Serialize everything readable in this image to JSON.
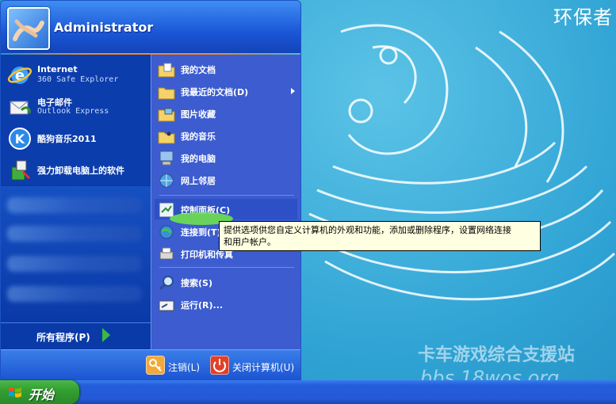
{
  "desktop": {
    "wallpaper_text": "环保者",
    "watermark_line1": "卡车游戏综合支援站",
    "watermark_line2": "bbs.18wos.org"
  },
  "start_menu": {
    "user_name": "Administrator",
    "pinned": [
      {
        "title": "Internet",
        "subtitle": "360 Safe Explorer",
        "icon": "internet-explorer-icon"
      },
      {
        "title": "电子邮件",
        "subtitle": "Outlook Express",
        "icon": "email-icon"
      }
    ],
    "recent": [
      {
        "title": "酷狗音乐2011",
        "icon": "kugou-music-icon"
      },
      {
        "title": "强力卸载电脑上的软件",
        "icon": "uninstall-software-icon"
      }
    ],
    "all_programs": "所有程序(P)",
    "right_items": [
      {
        "label": "我的文档",
        "icon": "my-documents-icon"
      },
      {
        "label": "我最近的文档(D)",
        "icon": "recent-documents-icon",
        "has_submenu": true
      },
      {
        "label": "图片收藏",
        "icon": "my-pictures-icon"
      },
      {
        "label": "我的音乐",
        "icon": "my-music-icon"
      },
      {
        "label": "我的电脑",
        "icon": "my-computer-icon"
      },
      {
        "label": "网上邻居",
        "icon": "network-places-icon"
      },
      {
        "label": "控制面板(C)",
        "icon": "control-panel-icon",
        "highlighted": true
      },
      {
        "label": "连接到(T)",
        "icon": "connect-to-icon"
      },
      {
        "label": "打印机和传真",
        "icon": "printers-faxes-icon"
      },
      {
        "label": "搜索(S)",
        "icon": "search-icon"
      },
      {
        "label": "运行(R)...",
        "icon": "run-icon"
      }
    ],
    "footer": {
      "logoff": "注销(L)",
      "shutdown": "关闭计算机(U)"
    }
  },
  "tooltip": {
    "line1": "提供选项供您自定义计算机的外观和功能，添加或删除程序，设置网络连接",
    "line2": "和用户帐户。"
  },
  "taskbar": {
    "start_label": "开始"
  },
  "colors": {
    "menu_blue": "#1a57d7",
    "right_pane": "#3c5ccf",
    "start_green": "#33a032",
    "tooltip_bg": "#ffffe1"
  }
}
